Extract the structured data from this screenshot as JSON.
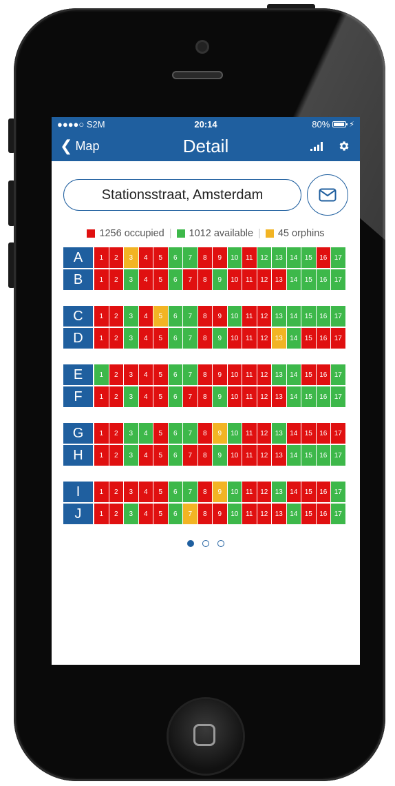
{
  "status_bar": {
    "carrier": "●●●●○ S2M",
    "time": "20:14",
    "battery": "80%",
    "bolt": "⚡"
  },
  "nav_bar": {
    "back_label": "Map",
    "title": "Detail",
    "back_icon": "chevron-left-icon",
    "signal_icon": "signal-bars-icon",
    "settings_icon": "gear-icon"
  },
  "location": {
    "value": "Stationsstraat, Amsterdam",
    "mail_icon": "mail-icon"
  },
  "legend": {
    "occupied": "1256 occupied",
    "available": "1012 available",
    "orphans": "45 orphins"
  },
  "colors": {
    "brand": "#1f5f9f",
    "occupied": "#e01010",
    "available": "#3db84a",
    "orphan": "#f2b424"
  },
  "grid": {
    "groups": [
      [
        {
          "label": "A",
          "cells": [
            "o",
            "o",
            "y",
            "o",
            "o",
            "g",
            "g",
            "o",
            "o",
            "g",
            "o",
            "g",
            "g",
            "g",
            "g",
            "o",
            "g"
          ]
        },
        {
          "label": "B",
          "cells": [
            "o",
            "o",
            "g",
            "o",
            "o",
            "g",
            "o",
            "o",
            "g",
            "o",
            "o",
            "o",
            "o",
            "g",
            "g",
            "g",
            "g"
          ]
        }
      ],
      [
        {
          "label": "C",
          "cells": [
            "o",
            "o",
            "g",
            "o",
            "y",
            "g",
            "g",
            "o",
            "o",
            "g",
            "o",
            "o",
            "g",
            "g",
            "g",
            "g",
            "g"
          ]
        },
        {
          "label": "D",
          "cells": [
            "o",
            "o",
            "g",
            "o",
            "o",
            "g",
            "g",
            "o",
            "g",
            "o",
            "o",
            "o",
            "y",
            "g",
            "o",
            "o",
            "o"
          ]
        }
      ],
      [
        {
          "label": "E",
          "cells": [
            "g",
            "o",
            "o",
            "o",
            "o",
            "g",
            "g",
            "o",
            "o",
            "o",
            "o",
            "o",
            "g",
            "g",
            "o",
            "o",
            "g"
          ]
        },
        {
          "label": "F",
          "cells": [
            "o",
            "o",
            "g",
            "o",
            "o",
            "g",
            "o",
            "o",
            "g",
            "o",
            "o",
            "o",
            "o",
            "g",
            "g",
            "g",
            "g"
          ]
        }
      ],
      [
        {
          "label": "G",
          "cells": [
            "o",
            "o",
            "g",
            "g",
            "o",
            "g",
            "g",
            "o",
            "y",
            "g",
            "o",
            "o",
            "g",
            "o",
            "o",
            "o",
            "o"
          ]
        },
        {
          "label": "H",
          "cells": [
            "o",
            "o",
            "g",
            "o",
            "o",
            "g",
            "o",
            "o",
            "g",
            "o",
            "o",
            "o",
            "o",
            "g",
            "g",
            "g",
            "g"
          ]
        }
      ],
      [
        {
          "label": "I",
          "cells": [
            "o",
            "o",
            "o",
            "o",
            "o",
            "g",
            "g",
            "o",
            "y",
            "g",
            "o",
            "o",
            "g",
            "o",
            "o",
            "o",
            "g"
          ]
        },
        {
          "label": "J",
          "cells": [
            "o",
            "o",
            "g",
            "o",
            "o",
            "g",
            "y",
            "o",
            "o",
            "g",
            "o",
            "o",
            "o",
            "g",
            "o",
            "o",
            "g"
          ]
        }
      ]
    ]
  },
  "pager": {
    "pages": 3,
    "current": 0
  }
}
